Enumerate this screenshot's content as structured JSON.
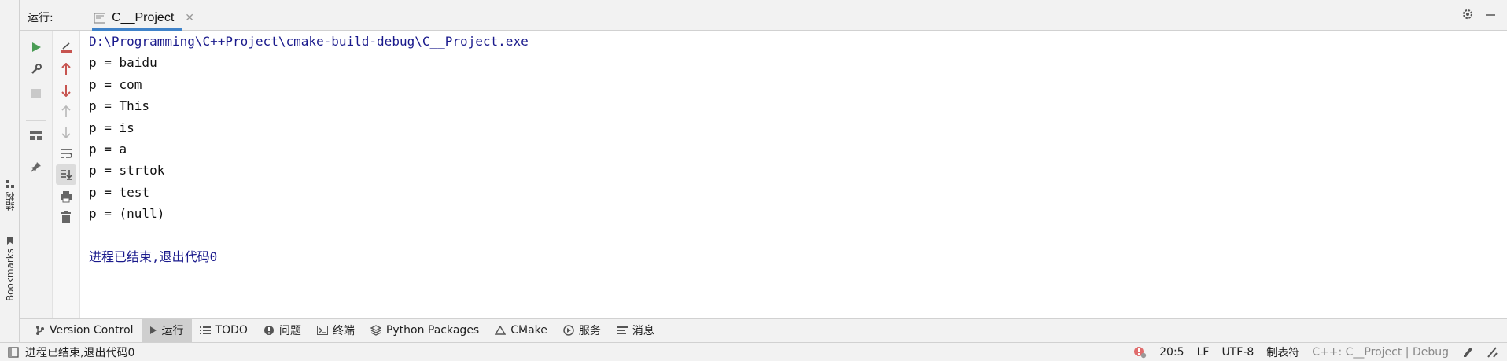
{
  "header": {
    "run_label": "运行:",
    "tab_title": "C__Project"
  },
  "stripe": {
    "structure_label": "结构",
    "bookmarks_label": "Bookmarks"
  },
  "console": {
    "path_line": "D:\\Programming\\C++Project\\cmake-build-debug\\C__Project.exe",
    "output_lines": [
      "p = baidu",
      "p = com",
      "p = This",
      "p = is",
      "p = a",
      "p = strtok",
      "p = test",
      "p = (null)"
    ],
    "exit_message": "进程已结束,退出代码0"
  },
  "tool_tabs": [
    {
      "label": "Version Control",
      "icon": "branch-icon"
    },
    {
      "label": "运行",
      "icon": "play-icon"
    },
    {
      "label": "TODO",
      "icon": "list-icon"
    },
    {
      "label": "问题",
      "icon": "info-icon"
    },
    {
      "label": "终端",
      "icon": "terminal-icon"
    },
    {
      "label": "Python Packages",
      "icon": "layers-icon"
    },
    {
      "label": "CMake",
      "icon": "triangle-icon"
    },
    {
      "label": "服务",
      "icon": "services-icon"
    },
    {
      "label": "消息",
      "icon": "messages-icon"
    }
  ],
  "status": {
    "message": "进程已结束,退出代码0",
    "position": "20:5",
    "line_separator": "LF",
    "encoding": "UTF-8",
    "indent": "制表符",
    "context": "C++: C__Project | Debug"
  },
  "colors": {
    "accent": "#4083c9",
    "run_green": "#499c54",
    "arrow_red": "#c75450",
    "console_link": "#1a1a8c"
  }
}
